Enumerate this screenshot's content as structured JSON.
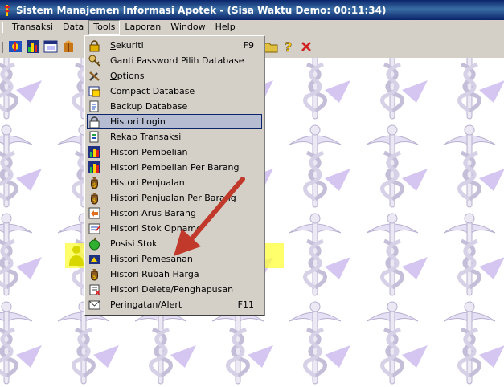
{
  "window": {
    "title": "Sistem Manajemen Informasi Apotek - (Sisa Waktu Demo: 00:11:34)"
  },
  "menubar": [
    {
      "label": "Transaksi",
      "underline": "T",
      "rest": "ransaksi"
    },
    {
      "label": "Data",
      "underline": "D",
      "rest": "ata"
    },
    {
      "label": "Tools",
      "pre": "To",
      "underline": "o",
      "rest": "ls"
    },
    {
      "label": "Laporan",
      "underline": "L",
      "rest": "aporan"
    },
    {
      "label": "Window",
      "underline": "W",
      "rest": "indow"
    },
    {
      "label": "Help",
      "underline": "H",
      "rest": "elp"
    }
  ],
  "toolbar": {
    "icons": [
      "network-icon",
      "chart-icon",
      "window-icon",
      "box-icon",
      "folder-icon",
      "help-icon",
      "close-icon"
    ]
  },
  "tools_menu": {
    "items": [
      {
        "label": "Sekuriti",
        "underline": "S",
        "rest": "ekuriti",
        "shortcut": "F9",
        "icon": "lock-icon"
      },
      {
        "label": "Ganti Password Pilih Database",
        "shortcut": "",
        "icon": "key-icon"
      },
      {
        "label": "Options",
        "underline": "O",
        "rest": "ptions",
        "shortcut": "",
        "icon": "tools-icon"
      },
      {
        "label": "Compact Database",
        "shortcut": "",
        "icon": "compact-icon"
      },
      {
        "label": "Backup Database",
        "shortcut": "",
        "icon": "backup-icon"
      },
      {
        "label": "Histori Login",
        "shortcut": "",
        "icon": "login-lock-icon",
        "selected": true
      },
      {
        "label": "Rekap Transaksi",
        "shortcut": "",
        "icon": "document-icon"
      },
      {
        "label": "Histori Pembelian",
        "shortcut": "",
        "icon": "chart-icon"
      },
      {
        "label": "Histori Pembelian Per Barang",
        "shortcut": "",
        "icon": "chart-icon"
      },
      {
        "label": "Histori Penjualan",
        "shortcut": "",
        "icon": "money-bag-icon"
      },
      {
        "label": "Histori Penjualan Per Barang",
        "shortcut": "",
        "icon": "money-bag-icon"
      },
      {
        "label": "Histori Arus Barang",
        "shortcut": "",
        "icon": "flow-icon"
      },
      {
        "label": "Histori Stok Opname",
        "shortcut": "",
        "icon": "stock-opname-icon"
      },
      {
        "label": "Posisi Stok",
        "shortcut": "",
        "icon": "apple-icon"
      },
      {
        "label": "Histori Pemesanan",
        "shortcut": "",
        "icon": "order-icon"
      },
      {
        "label": "Histori Rubah Harga",
        "shortcut": "",
        "icon": "money-bag-icon"
      },
      {
        "label": "Histori Delete/Penghapusan",
        "shortcut": "",
        "icon": "delete-icon"
      },
      {
        "label": "Peringatan/Alert",
        "shortcut": "F11",
        "icon": "alert-icon"
      }
    ]
  },
  "colors": {
    "titlebar": "#0a246a",
    "menu_bg": "#d4d0c8",
    "selection": "#b6bdd2",
    "highlight": "#ffff32",
    "arrow": "#c0392b",
    "caduceus": "#a48fd8"
  }
}
